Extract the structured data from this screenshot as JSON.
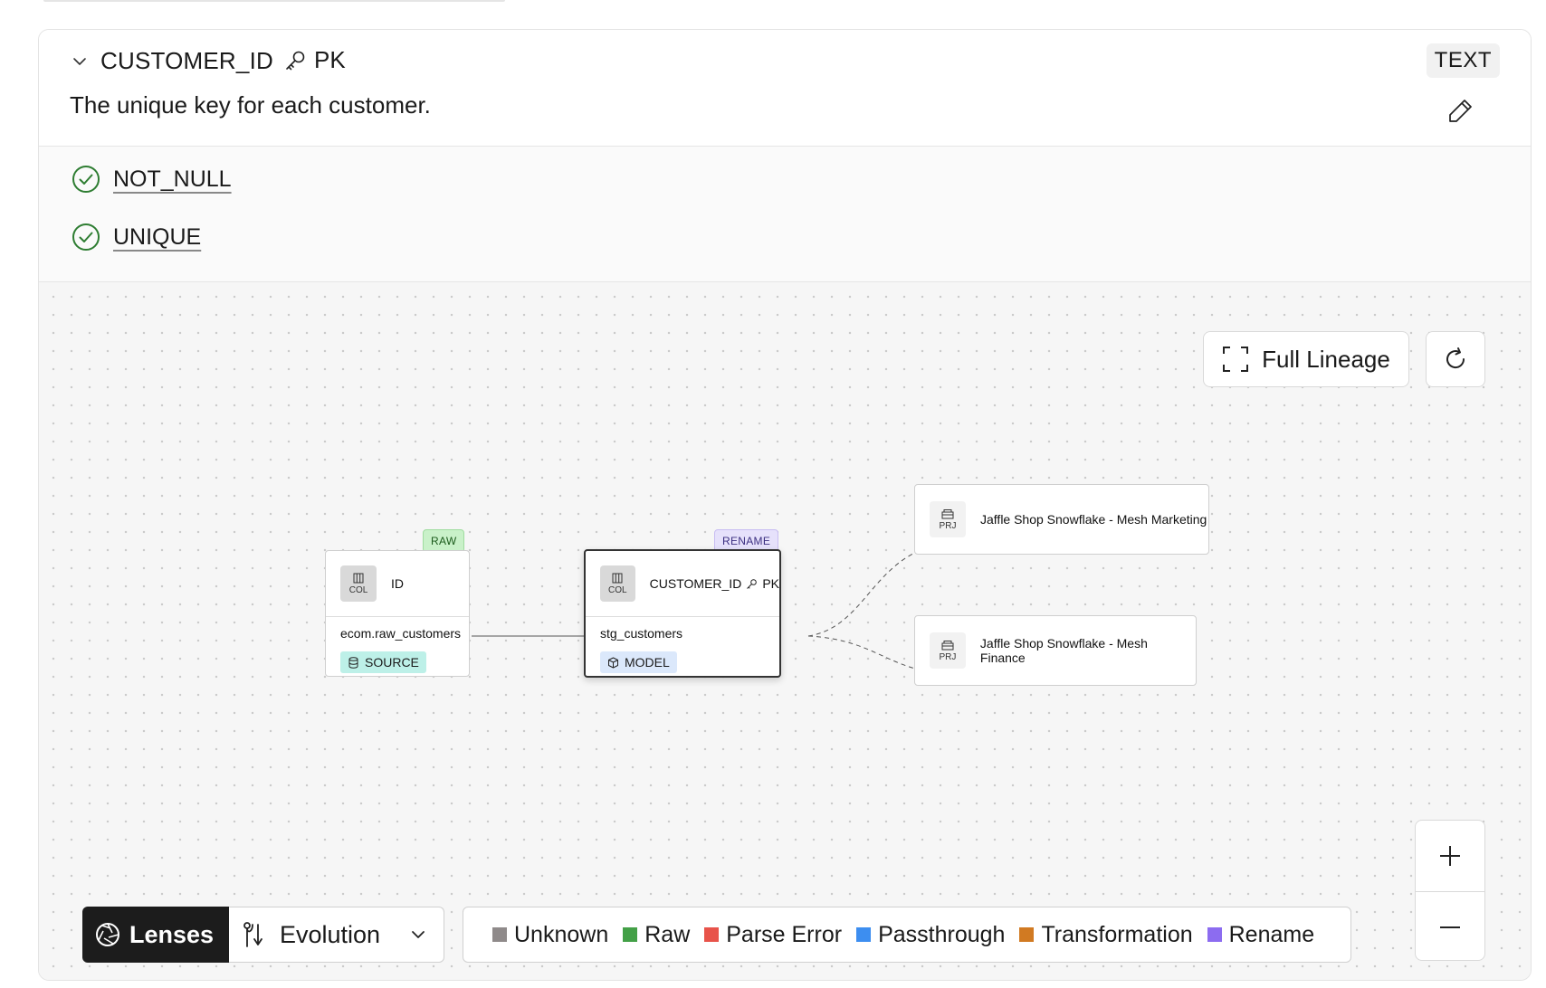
{
  "column": {
    "name": "CUSTOMER_ID",
    "pk_label": "PK",
    "data_type": "TEXT",
    "description": "The unique key for each customer."
  },
  "tests": [
    {
      "label": "NOT_NULL",
      "status": "pass"
    },
    {
      "label": "UNIQUE",
      "status": "pass"
    }
  ],
  "lineage": {
    "full_lineage_label": "Full Lineage",
    "nodes": {
      "source": {
        "kind_tag": "COL",
        "title": "ID",
        "model": "ecom.raw_customers",
        "resource_type": "SOURCE",
        "badge": "RAW"
      },
      "current": {
        "kind_tag": "COL",
        "title": "CUSTOMER_ID",
        "pk_label": "PK",
        "model": "stg_customers",
        "resource_type": "MODEL",
        "badge": "RENAME"
      },
      "downstream": [
        {
          "kind_tag": "PRJ",
          "title": "Jaffle Shop Snowflake - Mesh Marketing"
        },
        {
          "kind_tag": "PRJ",
          "title": "Jaffle Shop Snowflake - Mesh Finance"
        }
      ]
    },
    "lenses": {
      "button_label": "Lenses",
      "selected": "Evolution"
    },
    "legend": [
      {
        "label": "Unknown",
        "color": "#8f8a8a"
      },
      {
        "label": "Raw",
        "color": "#43a047"
      },
      {
        "label": "Parse Error",
        "color": "#e8534a"
      },
      {
        "label": "Passthrough",
        "color": "#3d8ef0"
      },
      {
        "label": "Transformation",
        "color": "#d17a22"
      },
      {
        "label": "Rename",
        "color": "#8c6cf0"
      }
    ]
  },
  "colors": {
    "test_pass": "#2e7d32",
    "lens_dark": "#1c1c1c"
  }
}
